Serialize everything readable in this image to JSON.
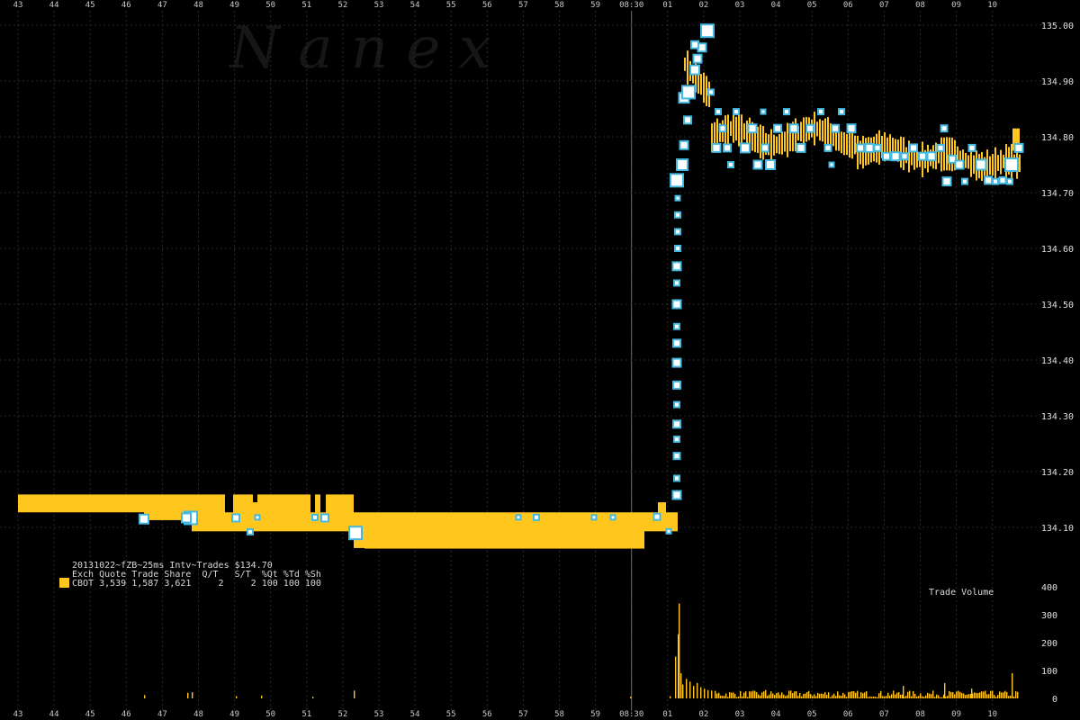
{
  "chart_data": {
    "type": "scatter",
    "watermark": "N a n e x",
    "legend": {
      "line1": "20131022~fZB~25ms Intv~Trades $134.70",
      "line2": "Exch Quote Trade Share  Q/T   S/T  %Qt %Td %Sh",
      "line3": "CBOT 3,539 1,587 3,621     2     2 100 100 100",
      "swatch_color": "#ffc61e"
    },
    "x_axis": {
      "ticks": [
        "43",
        "44",
        "45",
        "46",
        "47",
        "48",
        "49",
        "50",
        "51",
        "52",
        "53",
        "54",
        "55",
        "56",
        "57",
        "58",
        "59",
        "08:30",
        "01",
        "02",
        "03",
        "04",
        "05",
        "06",
        "07",
        "08",
        "09",
        "10"
      ],
      "marker": "08:30"
    },
    "y_axis": {
      "ticks": [
        "135.00",
        "134.90",
        "134.80",
        "134.70",
        "134.60",
        "134.50",
        "134.40",
        "134.30",
        "134.20",
        "134.10"
      ],
      "ylim": [
        134.03,
        135.0
      ]
    },
    "volume_panel": {
      "title": "Trade Volume",
      "ticks": [
        "400",
        "300",
        "200",
        "100",
        "0"
      ],
      "ylim": [
        0,
        400
      ]
    },
    "colors": {
      "quote_band": "#ffc61e",
      "trade_marker": "#43b8e0",
      "grid": "#2a2a2a"
    }
  }
}
